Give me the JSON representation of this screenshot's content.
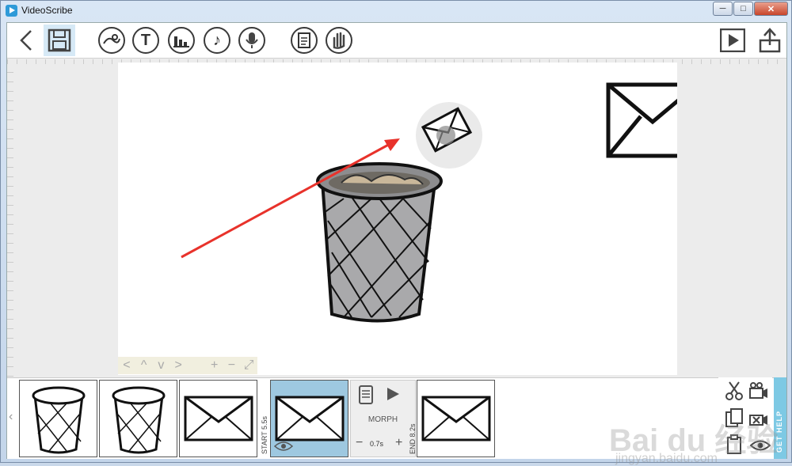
{
  "window": {
    "title": "VideoScribe",
    "min_label": "─",
    "max_label": "□",
    "close_label": "✕"
  },
  "toolbar": {
    "text_icon_glyph": "T",
    "audio_icon_glyph": "♪"
  },
  "canvas_nav": {
    "left": "<",
    "up": "^",
    "down": "v",
    "right": ">",
    "zoom_in": "+",
    "zoom_out": "−",
    "fit": "⤢"
  },
  "timeline": {
    "props": {
      "transition": "MORPH",
      "duration": "0.7s",
      "minus": "−",
      "plus": "+",
      "start_label": "START",
      "start_time": "5.5s",
      "end_label": "END",
      "end_time": "8.2s"
    }
  },
  "help_tab": {
    "label": "GET HELP"
  },
  "watermark": {
    "brand": "Bai du 经验",
    "url": "jingyan.baidu.com"
  },
  "colors": {
    "accent": "#7dc9e4",
    "selected": "#9ec8e0",
    "arrow": "#e8322b"
  }
}
